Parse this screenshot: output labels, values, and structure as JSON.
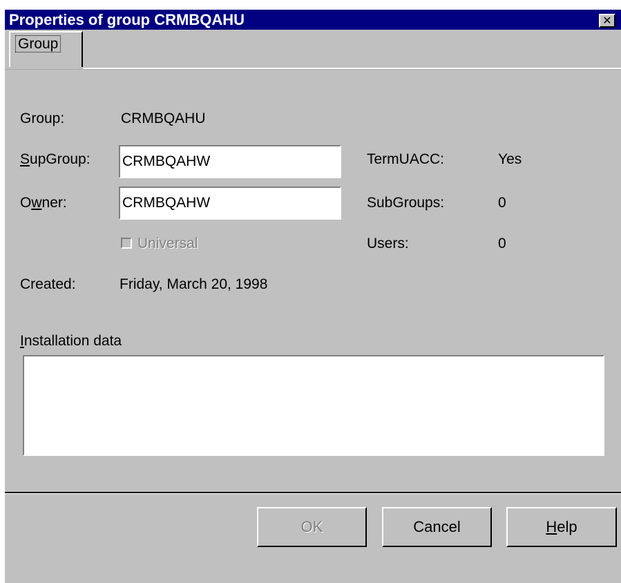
{
  "window": {
    "title": "Properties of group CRMBQAHU",
    "close_glyph": "✕"
  },
  "tabs": [
    {
      "label": "Group",
      "selected": true
    }
  ],
  "form": {
    "group_label": "Group:",
    "group_value": "CRMBQAHU",
    "supgroup_label_first": "S",
    "supgroup_label_rest": "upGroup:",
    "supgroup_value": "CRMBQAHW",
    "owner_label_first": "O",
    "owner_label_mnemonic": "w",
    "owner_label_rest": "ner:",
    "owner_value": "CRMBQAHW",
    "universal_label": "Universal",
    "universal_checked": false,
    "universal_enabled": false,
    "created_label": "Created:",
    "created_value": "Friday, March 20, 1998",
    "termuacc_label": "TermUACC:",
    "termuacc_value": "Yes",
    "subgroups_label": "SubGroups:",
    "subgroups_value": "0",
    "users_label": "Users:",
    "users_value": "0",
    "installation_label_first": "I",
    "installation_label_rest": "nstallation data",
    "installation_value": ""
  },
  "buttons": {
    "ok_label": "OK",
    "ok_enabled": false,
    "cancel_label": "Cancel",
    "help_label_first": "H",
    "help_label_rest": "elp"
  },
  "colors": {
    "titlebar": "#000080",
    "face": "#c0c0c0",
    "disabled_text": "#808080"
  },
  "icons": {
    "close": "close-icon",
    "checkbox": "checkbox-icon"
  }
}
